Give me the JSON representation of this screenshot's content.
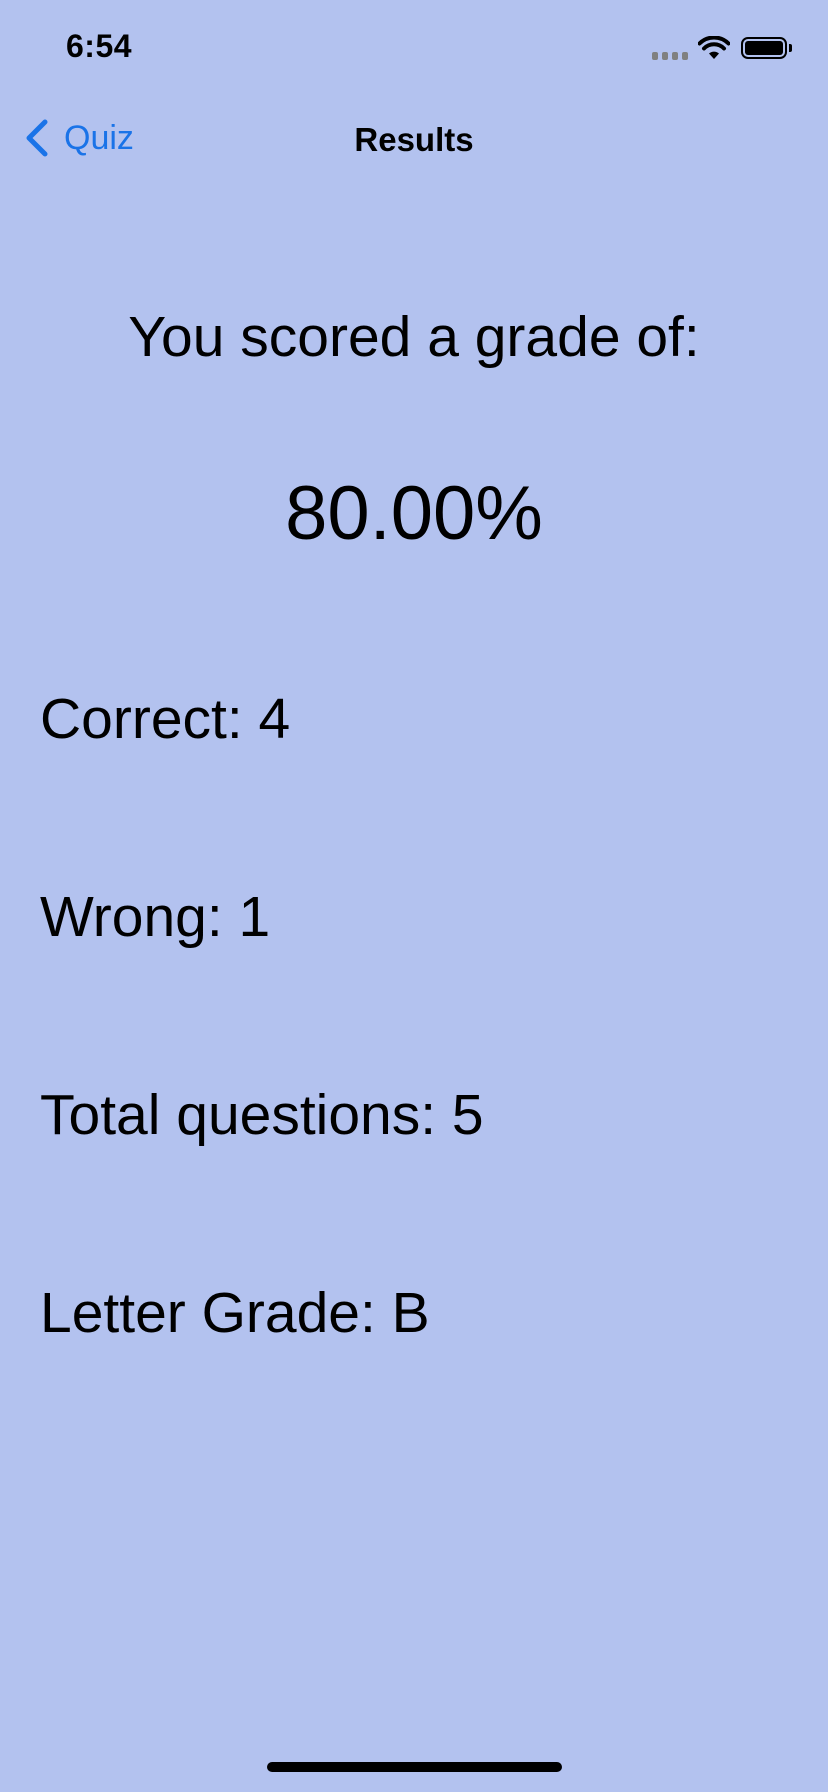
{
  "status_bar": {
    "time": "6:54",
    "icons": [
      "cellular-signal-icon",
      "wifi-icon",
      "battery-icon"
    ]
  },
  "nav": {
    "back_label": "Quiz",
    "title": "Results"
  },
  "results": {
    "heading": "You scored a grade of:",
    "percent": "80.00%",
    "correct": "Correct: 4",
    "wrong": "Wrong: 1",
    "total": "Total questions: 5",
    "letter_grade": "Letter Grade: B"
  },
  "colors": {
    "background": "#b3c2ef",
    "accent": "#1a73e8"
  }
}
